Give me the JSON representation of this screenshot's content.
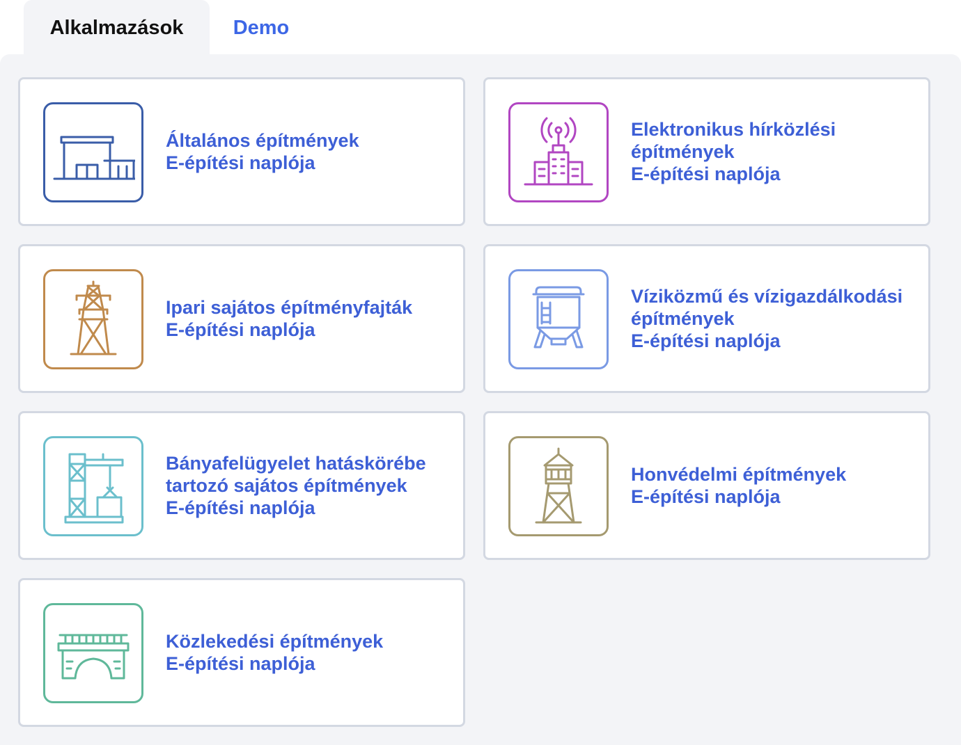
{
  "tabs": {
    "active_label": "Alkalmazások",
    "demo_label": "Demo"
  },
  "cards": [
    {
      "title": "Általános építmények\nE-építési naplója",
      "icon": "building-icon",
      "color": "#3a5da8"
    },
    {
      "title": "Elektronikus hírközlési\népítmények\nE-építési naplója",
      "icon": "antenna-tower-icon",
      "color": "#b146c2"
    },
    {
      "title": "Ipari sajátos építményfajták\nE-építési naplója",
      "icon": "power-pylon-icon",
      "color": "#c08a4c"
    },
    {
      "title": "Víziközmű és vízigazdálkodási\népítmények\nE-építési naplója",
      "icon": "water-tank-icon",
      "color": "#7a9ae4"
    },
    {
      "title": "Bányafelügyelet hatáskörébe\ntartozó sajátos építmények\nE-építési naplója",
      "icon": "mining-crane-icon",
      "color": "#6bbfcc"
    },
    {
      "title": "Honvédelmi építmények\nE-építési naplója",
      "icon": "watchtower-icon",
      "color": "#a59a70"
    },
    {
      "title": "Közlekedési építmények\nE-építési naplója",
      "icon": "bridge-icon",
      "color": "#5fb89a"
    }
  ]
}
